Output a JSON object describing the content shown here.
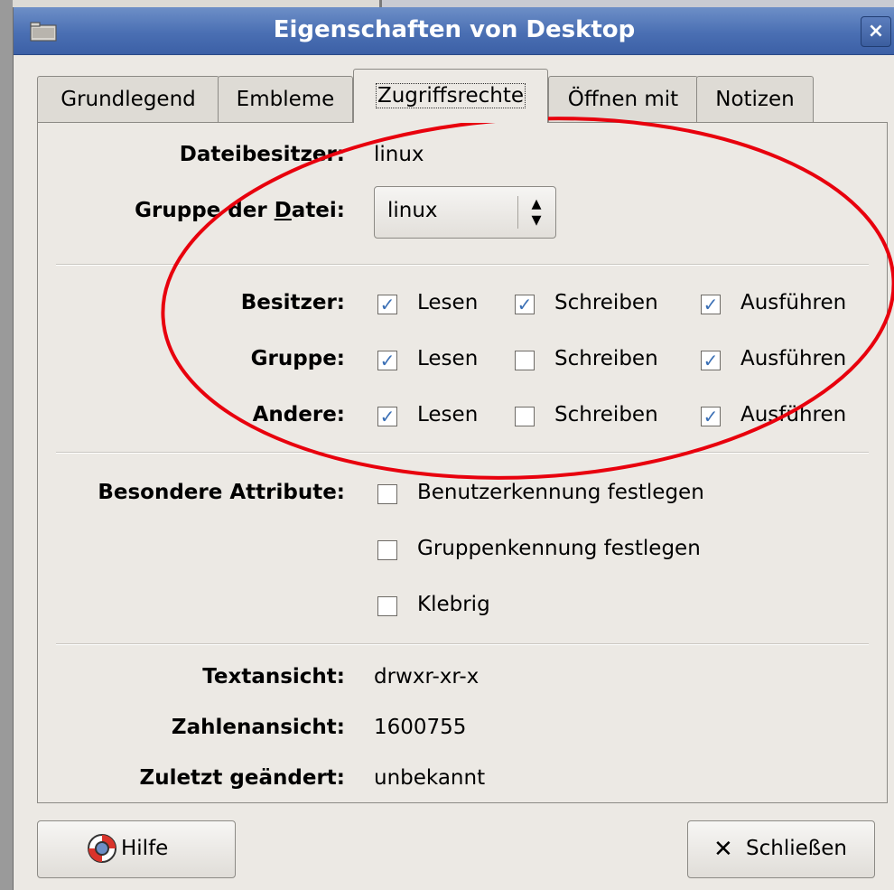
{
  "window": {
    "title": "Eigenschaften von Desktop",
    "close_label": "×"
  },
  "tabs": [
    {
      "label": "Grundlegend"
    },
    {
      "label": "Embleme"
    },
    {
      "label": "Zugriffsrechte"
    },
    {
      "label": "Öffnen mit"
    },
    {
      "label": "Notizen"
    }
  ],
  "owner": {
    "label": "Dateibesitzer:",
    "value": "linux"
  },
  "group": {
    "label_pre": "Gruppe der ",
    "label_mn": "D",
    "label_post": "atei:",
    "value": "linux"
  },
  "permissions": {
    "rows": [
      {
        "label": "Besitzer:",
        "read": "Lesen",
        "write": "Schreiben",
        "exec": "Ausführen",
        "read_checked": true,
        "write_checked": true,
        "exec_checked": true
      },
      {
        "label": "Gruppe:",
        "read": "Lesen",
        "write": "Schreiben",
        "exec": "Ausführen",
        "read_checked": true,
        "write_checked": false,
        "exec_checked": true
      },
      {
        "label": "Andere:",
        "read": "Lesen",
        "write": "Schreiben",
        "exec": "Ausführen",
        "read_checked": true,
        "write_checked": false,
        "exec_checked": true
      }
    ]
  },
  "special": {
    "label": "Besondere Attribute:",
    "items": [
      {
        "label": "Benutzerkennung festlegen",
        "checked": false
      },
      {
        "label": "Gruppenkennung festlegen",
        "checked": false
      },
      {
        "label": "Klebrig",
        "checked": false
      }
    ]
  },
  "info": {
    "text_label": "Textansicht:",
    "text_value": "drwxr-xr-x",
    "num_label": "Zahlenansicht:",
    "num_value": "1600755",
    "mod_label": "Zuletzt geändert:",
    "mod_value": "unbekannt"
  },
  "buttons": {
    "help_label": "Hilfe",
    "close_label": "Schließen"
  },
  "colors": {
    "titlebar": "#4a6fb3",
    "check": "#3a6fb5",
    "annotation": "#e8000d"
  },
  "icons": {
    "help": "lifebuoy-icon",
    "close": "x-mark-icon",
    "title": "folder-icon"
  }
}
